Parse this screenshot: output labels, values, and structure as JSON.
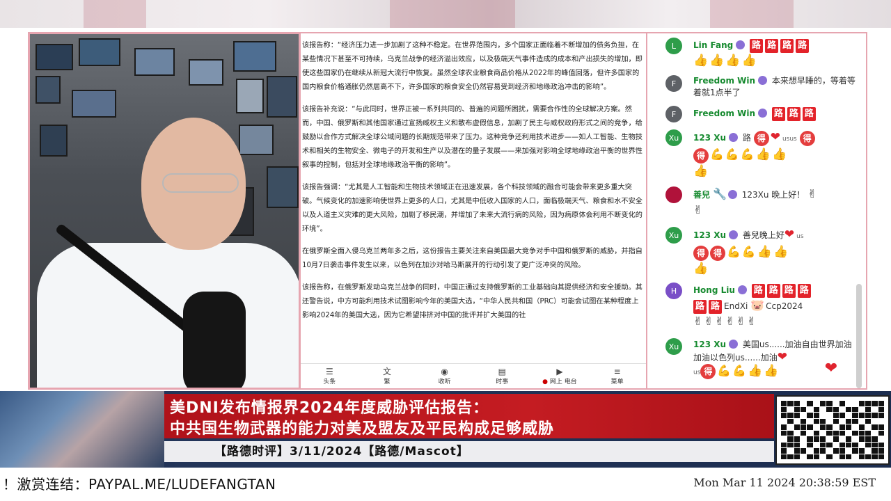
{
  "article": {
    "paragraphs": [
      "该报告称：“经济压力进一步加剧了这种不稳定。在世界范围内，多个国家正面临着不断增加的债务负担，在某些情况下甚至不可持续，乌克兰战争的经济溢出效应，以及极端天气事件造成的成本和产出损失的增加，即使这些国家仍在继续从新冠大流行中恢复。虽然全球农业粮食商品价格从2022年的峰值回落，但许多国家的国内粮食价格通胀仍然居高不下，许多国家的粮食安全仍然容易受到经济和地缘政治冲击的影响”。",
      "该报告补充说：“与此同时，世界正被一系列共同的、普遍的问题所困扰，需要合作性的全球解决方案。然而，中国、俄罗斯和其他国家通过宣扬威权主义和散布虚假信息，加剧了民主与威权政府形式之间的竞争，给鼓励以合作方式解决全球公域问题的长期规范带来了压力。这种竞争还利用技术进步——如人工智能、生物技术和相关的生物安全、微电子的开发和生产以及潜在的量子发展——来加强对影响全球地缘政治平衡的世界性叙事的控制，包括对全球地缘政治平衡的影响”。",
      "该报告强调：“尤其是人工智能和生物技术领域正在迅速发展，各个科技领域的融合可能会带来更多重大突破。气候变化的加速影响使世界上更多的人口，尤其是中低收入国家的人口，面临极端天气、粮食和水不安全以及人道主义灾难的更大风险，加剧了移民潮，并增加了未来大流行病的风险，因为病原体会利用不断变化的环境”。",
      "在俄罗斯全面入侵乌克兰两年多之后，这份报告主要关注来自美国最大竞争对手中国和俄罗斯的威胁，并指自10月7日袭击事件发生以来，以色列在加沙对哈马斯展开的行动引发了更广泛冲突的风险。",
      "该报告称，在俄罗斯发动乌克兰战争的同时，中国正通过支持俄罗斯的工业基础向其提供经济和安全援助。其还警告说，中方可能利用技术试图影响今年的美国大选，“中华人民共和国（PRC）可能会试图在某种程度上影响2024年的美国大选，因为它希望排挤对中国的批评并扩大美国的社"
    ],
    "nav": [
      {
        "icon": "headline-icon",
        "glyph": "☰",
        "label": "头条"
      },
      {
        "icon": "translate-icon",
        "glyph": "文",
        "label": "繁"
      },
      {
        "icon": "radio-icon",
        "glyph": "◉",
        "label": "收听"
      },
      {
        "icon": "news-icon",
        "glyph": "▤",
        "label": "时事"
      },
      {
        "icon": "play-icon",
        "glyph": "▶",
        "label": "网上 电台",
        "live": "●"
      },
      {
        "icon": "menu-icon",
        "glyph": "≡",
        "label": "菜单"
      }
    ]
  },
  "chat": {
    "messages": [
      {
        "initial": "L",
        "color": "#2e9d4a",
        "author": "Lin Fang",
        "text": "",
        "roads": 4,
        "thumbs": 4
      },
      {
        "initial": "F",
        "color": "#5e6166",
        "author": "Freedom Win",
        "text": "本来想早睡的，等着等着就1点半了"
      },
      {
        "initial": "F",
        "color": "#5e6166",
        "author": "Freedom Win",
        "text": "",
        "roads": 3
      },
      {
        "initial": "Xu",
        "color": "#2e9d4a",
        "author": "123 Xu",
        "text": "路",
        "tail": "usus"
      },
      {
        "initial": "",
        "color": "#b0123a",
        "author": "善兒",
        "text": "123Xu 晚上好！"
      },
      {
        "initial": "Xu",
        "color": "#2e9d4a",
        "author": "123 Xu",
        "text": "善兒晚上好",
        "tail": "us"
      },
      {
        "initial": "H",
        "color": "#7a4fc7",
        "author": "Hong Liu",
        "text": "EndXi",
        "tail2": "Ccp2024",
        "roads": 6
      },
      {
        "initial": "Xu",
        "color": "#2e9d4a",
        "author": "123 Xu",
        "text": "美国us......加油自由世界加油加油以色列us......加油",
        "tail": "us"
      }
    ]
  },
  "lower_third": {
    "title_line1": "美DNI发布情报界2024年度威胁评估报告：",
    "title_line2": "中共国生物武器的能力对美及盟友及平民构成足够威胁",
    "subtitle": "【路德时评】3/11/2024【路德/Mascot】"
  },
  "footer": {
    "paypal": "！激赏连结：PAYPAL.ME/LUDEFANGTAN",
    "clock": "Mon Mar 11 2024 20:38:59 EST"
  },
  "colors": {
    "accent_red": "#c41c22",
    "border_pink": "#e6a5b0",
    "author_green": "#168a2f"
  }
}
